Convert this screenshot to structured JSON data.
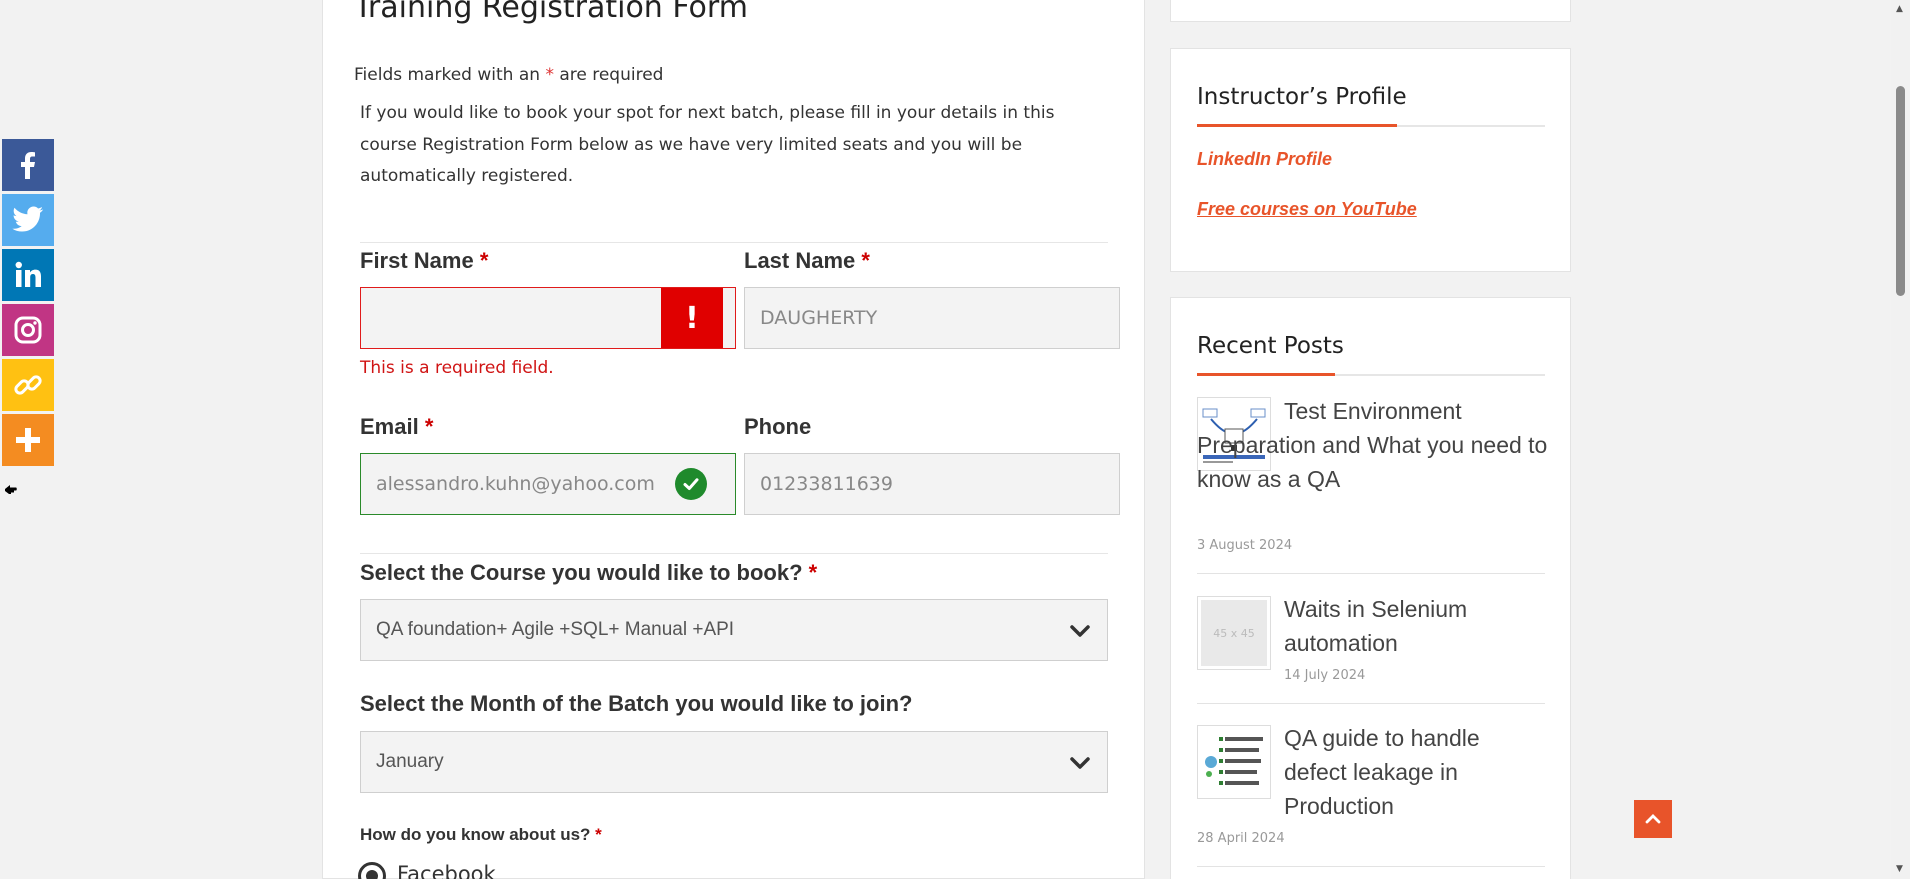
{
  "form": {
    "title": "Training Registration Form",
    "required_note_prefix": "Fields marked with an ",
    "required_star": "*",
    "required_note_suffix": " are required",
    "intro": "If you would like to book your spot for next batch, please fill in your details in this course Registration Form below as we have very limited seats and you will be automatically registered.",
    "first_name": {
      "label": "First Name",
      "value": "",
      "error": "This is a required field.",
      "error_badge": "!"
    },
    "last_name": {
      "label": "Last Name",
      "value": "DAUGHERTY"
    },
    "email": {
      "label": "Email",
      "value": "alessandro.kuhn@yahoo.com"
    },
    "phone": {
      "label": "Phone",
      "value": "01233811639"
    },
    "course": {
      "label": "Select the Course you would like to book?",
      "selected": "QA foundation+ Agile +SQL+ Manual +API"
    },
    "month": {
      "label": "Select the Month of the Batch you would like to join?",
      "selected": "January"
    },
    "source": {
      "label": "How do you know about us?",
      "option1": "Facebook"
    }
  },
  "sidebar": {
    "instructor": {
      "title": "Instructor’s Profile",
      "linkedin": "LinkedIn Profile",
      "youtube": "Free courses on YouTube"
    },
    "recent": {
      "title": "Recent Posts",
      "posts": [
        {
          "title": "Test Environment Preparation and What you need to know as a QA",
          "date": "3 August 2024",
          "thumb": ""
        },
        {
          "title": "Waits in Selenium automation",
          "date": "14 July 2024",
          "thumb": "45 x 45"
        },
        {
          "title": "QA guide to handle defect leakage in Production",
          "date": "28 April 2024",
          "thumb": ""
        }
      ]
    }
  },
  "share_bar": {
    "icons": [
      "facebook-icon",
      "twitter-icon",
      "linkedin-icon",
      "instagram-icon",
      "copy-link-icon",
      "more-icon"
    ],
    "colors": {
      "facebook": "#3b5998",
      "twitter": "#55acee",
      "linkedin": "#0077b5",
      "instagram": "#c13584",
      "copy": "#ffc112",
      "more": "#f48c21"
    }
  },
  "colors": {
    "accent": "#e8542a",
    "error": "#e00000",
    "success": "#1f8a2c"
  }
}
